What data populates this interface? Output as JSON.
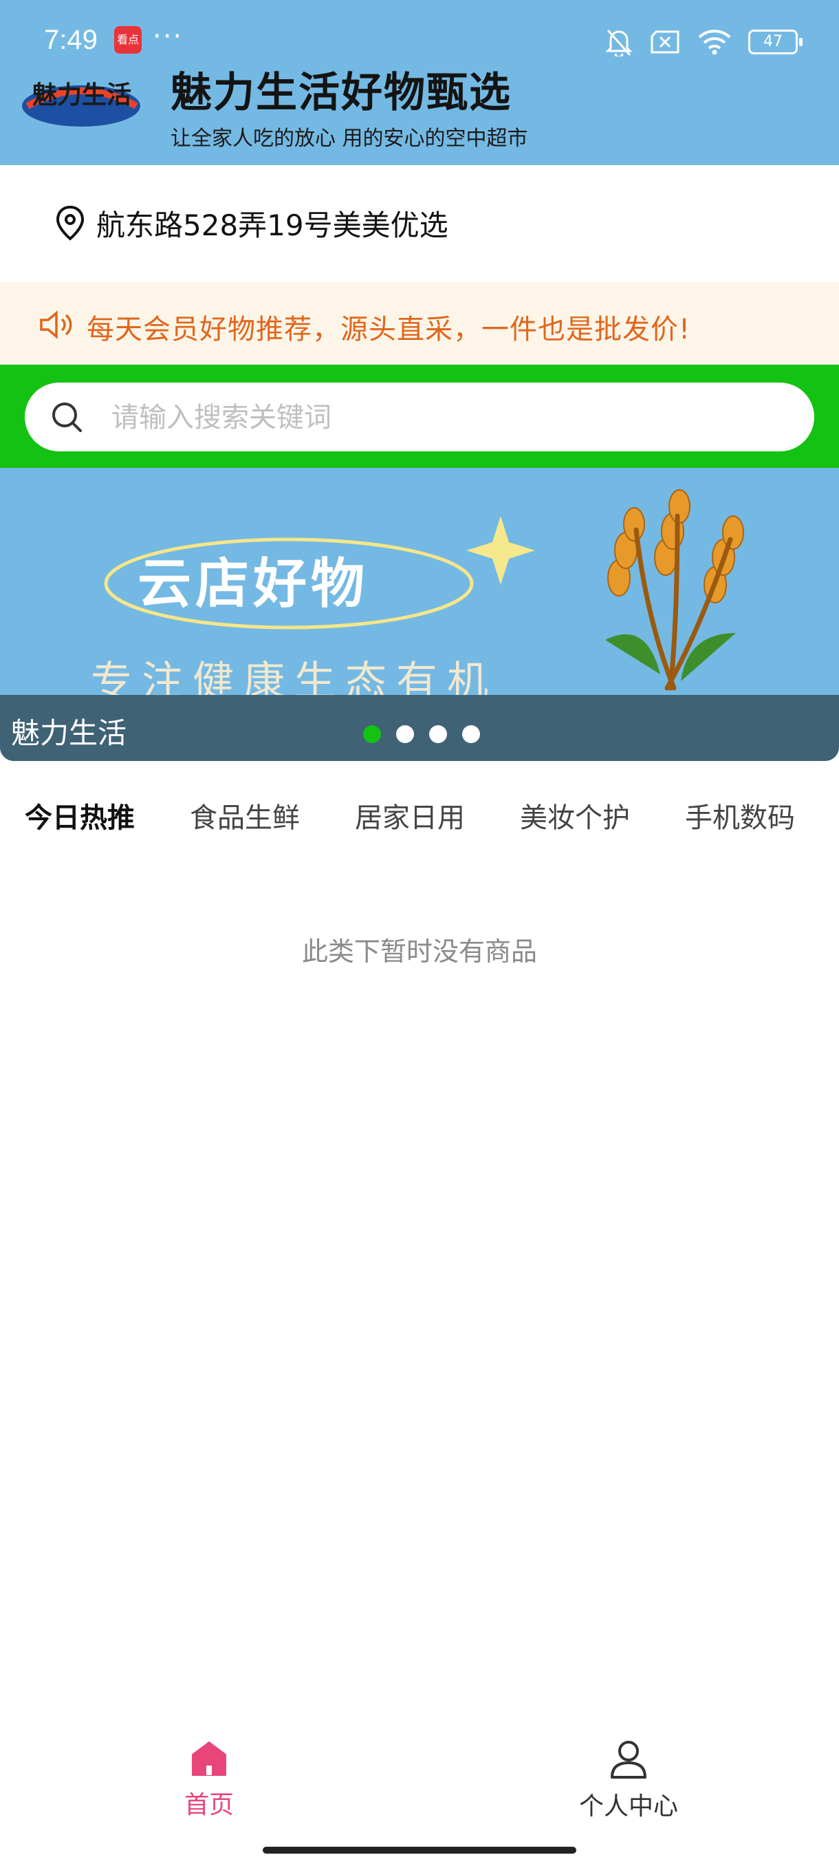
{
  "status_bar": {
    "time": "7:49",
    "app_badge": "看点",
    "overflow": "···",
    "battery": "47",
    "icons": [
      "bell-muted-icon",
      "no-sim-icon",
      "wifi-icon",
      "battery-icon"
    ]
  },
  "header": {
    "logo_text": "魅力生活",
    "title": "魅力生活好物甄选",
    "subtitle": "让全家人吃的放心 用的安心的空中超市",
    "background": "#74b9e3"
  },
  "address": {
    "icon": "location-pin-icon",
    "text": "航东路528弄19号美美优选"
  },
  "notice": {
    "icon": "speaker-icon",
    "text": "每天会员好物推荐，源头直采，一件也是批发价!",
    "color": "#e0661c"
  },
  "search": {
    "placeholder": "请输入搜索关键词",
    "band_color": "#13c213"
  },
  "banner": {
    "headline": "云店好物",
    "tagline": "专注健康生态有机",
    "caption": "魅力生活",
    "slide_count": 4,
    "active_slide": 1
  },
  "tabs": [
    {
      "label": "今日热推",
      "active": true
    },
    {
      "label": "食品生鲜",
      "active": false
    },
    {
      "label": "居家日用",
      "active": false
    },
    {
      "label": "美妆个护",
      "active": false
    },
    {
      "label": "手机数码",
      "active": false
    }
  ],
  "empty_message": "此类下暂时没有商品",
  "bottom_nav": [
    {
      "label": "首页",
      "icon": "home-icon",
      "active": true
    },
    {
      "label": "个人中心",
      "icon": "user-icon",
      "active": false
    }
  ],
  "colors": {
    "accent_green": "#13c213",
    "nav_active": "#e8457a",
    "nav_inactive": "#333333"
  }
}
